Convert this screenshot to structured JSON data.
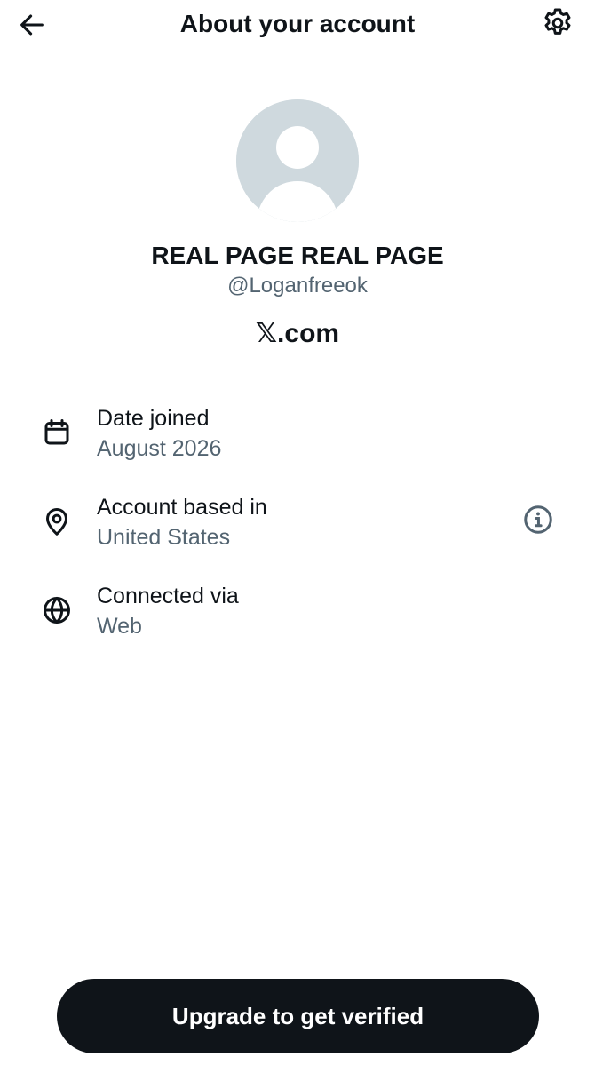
{
  "header": {
    "title": "About your account",
    "back_icon": "arrow-left-icon",
    "settings_icon": "gear-icon"
  },
  "profile": {
    "avatar_icon": "person-placeholder-icon",
    "display_name": "REAL PAGE REAL PAGE",
    "handle": "@Loganfreeok",
    "site": "𝕏.com"
  },
  "details": [
    {
      "icon": "calendar-icon",
      "label": "Date joined",
      "value": "August 2026"
    },
    {
      "icon": "location-pin-icon",
      "label": "Account based in",
      "value": "United States",
      "info_icon": "info-circle-icon"
    },
    {
      "icon": "globe-icon",
      "label": "Connected via",
      "value": "Web"
    }
  ],
  "cta": {
    "label": "Upgrade to get verified"
  },
  "colors": {
    "text_primary": "#0f1419",
    "text_secondary": "#536471",
    "button_bg": "#0f1419",
    "button_text": "#ffffff",
    "background": "#ffffff"
  }
}
